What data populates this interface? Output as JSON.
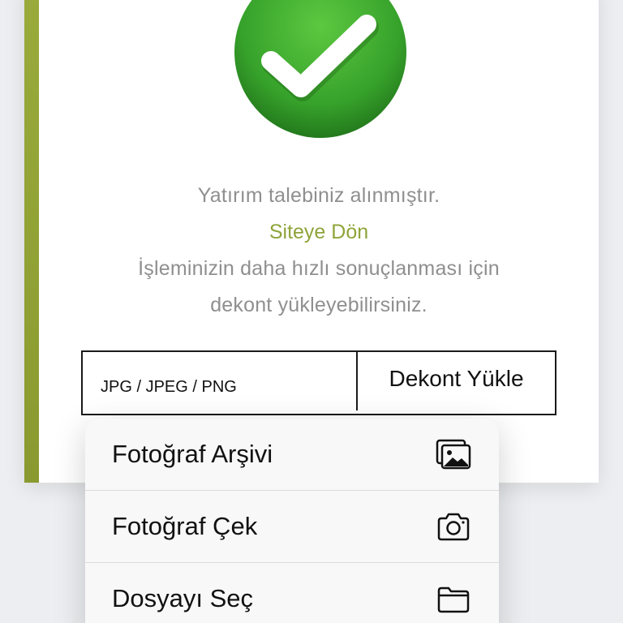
{
  "status": {
    "icon": "success-checkmark-icon",
    "message": "Yatırım talebiniz alınmıştır.",
    "return_link": "Siteye Dön",
    "hint_line1": "İşleminizin daha hızlı sonuçlanması için",
    "hint_line2": "dekont yükleyebilirsiniz."
  },
  "upload": {
    "accepted_types": "JPG / JPEG / PNG",
    "button_label": "Dekont Yükle"
  },
  "menu": {
    "items": [
      {
        "label": "Fotoğraf Arşivi",
        "icon": "photo-library-icon"
      },
      {
        "label": "Fotoğraf Çek",
        "icon": "camera-icon"
      },
      {
        "label": "Dosyayı Seç",
        "icon": "folder-icon"
      }
    ]
  },
  "colors": {
    "accent": "#8ea43a",
    "success": "#3aa12e",
    "text_muted": "#8f8f8f"
  }
}
